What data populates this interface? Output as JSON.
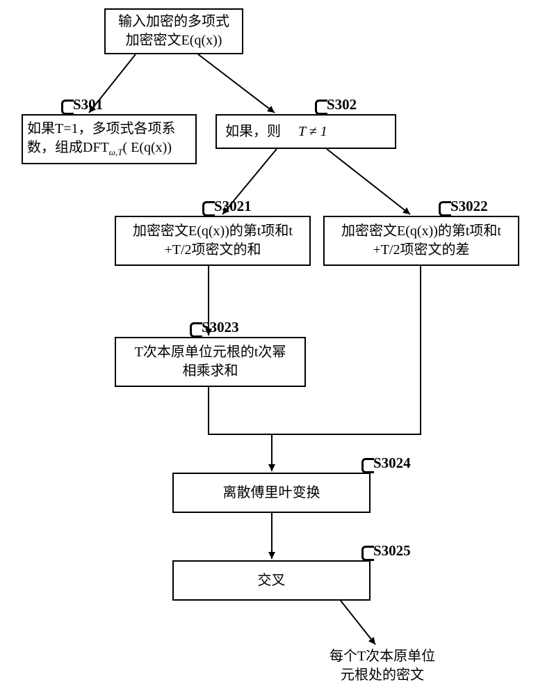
{
  "input": {
    "line1": "输入加密的多项式",
    "line2": "加密密文E(q(x))"
  },
  "s301": {
    "label": "S301",
    "line1": "如果T=1，多项式各项系",
    "line2": "数，组成DFT",
    "line2_sub": "ω,T",
    "line2_tail": "( E(q(x))"
  },
  "s302": {
    "label": "S302",
    "text_left": "如果，则",
    "text_right": "T ≠ 1"
  },
  "s3021": {
    "label": "S3021",
    "line1": "加密密文E(q(x))的第t项和t",
    "line2": "+T/2项密文的和"
  },
  "s3022": {
    "label": "S3022",
    "line1": "加密密文E(q(x))的第t项和t",
    "line2": "+T/2项密文的差"
  },
  "s3023": {
    "label": "S3023",
    "line1": "T次本原单位元根的t次幂",
    "line2": "相乘求和"
  },
  "s3024": {
    "label": "S3024",
    "text": "离散傅里叶变换"
  },
  "s3025": {
    "label": "S3025",
    "text": "交叉"
  },
  "output": {
    "line1": "每个T次本原单位",
    "line2": "元根处的密文"
  }
}
